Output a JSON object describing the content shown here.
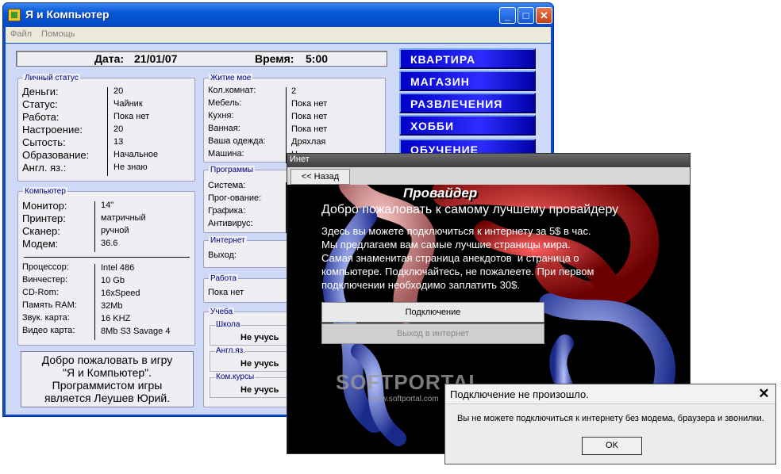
{
  "main_window": {
    "title": "Я и Компьютер",
    "menu": [
      "Файл",
      "Помощь"
    ],
    "date_label": "Дата:",
    "date_value": "21/01/07",
    "time_label": "Время:",
    "time_value": "5:00",
    "personal_status": {
      "legend": "Личный статус",
      "rows": [
        {
          "label": "Деньги:",
          "value": "20"
        },
        {
          "label": "Статус:",
          "value": "Чайник"
        },
        {
          "label": "Работа:",
          "value": "Пока нет"
        },
        {
          "label": "Настроение:",
          "value": "20"
        },
        {
          "label": "Сытость:",
          "value": "13"
        },
        {
          "label": "Образование:",
          "value": "Начальное"
        },
        {
          "label": "Англ. яз.:",
          "value": "Не знаю"
        }
      ]
    },
    "computer": {
      "legend": "Компьютер",
      "top_rows": [
        {
          "label": "Монитор:",
          "value": "14\""
        },
        {
          "label": "Принтер:",
          "value": "матричный"
        },
        {
          "label": "Сканер:",
          "value": "ручной"
        },
        {
          "label": "Модем:",
          "value": "36.6"
        }
      ],
      "bottom_rows": [
        {
          "label": "Процессор:",
          "value": "Intel 486"
        },
        {
          "label": "Винчестер:",
          "value": "10 Gb"
        },
        {
          "label": "CD-Rom:",
          "value": "16xSpeed"
        },
        {
          "label": "Память RAM:",
          "value": "32Mb"
        },
        {
          "label": "Звук. карта:",
          "value": "16 KHZ"
        },
        {
          "label": "Видео карта:",
          "value": "8Mb S3 Savage 4"
        }
      ]
    },
    "living": {
      "legend": "Житие мое",
      "rows": [
        {
          "label": "Кол.комнат:",
          "value": "2"
        },
        {
          "label": "Мебель:",
          "value": "Пока нет"
        },
        {
          "label": "Кухня:",
          "value": "Пока нет"
        },
        {
          "label": "Ванная:",
          "value": "Пока нет"
        },
        {
          "label": "Ваша одежда:",
          "value": "Дряхлая"
        },
        {
          "label": "Машина:",
          "value": "Н"
        }
      ]
    },
    "programs": {
      "legend": "Программы",
      "rows": [
        "Система:",
        "Прог-ование:",
        "Графика:",
        "Антивирус:"
      ]
    },
    "internet": {
      "legend": "Интернет",
      "label": "Выход:"
    },
    "work": {
      "legend": "Работа",
      "value": "Пока нет"
    },
    "study": {
      "legend": "Учеба",
      "items": [
        {
          "label": "Школа",
          "value": "Не учусь"
        },
        {
          "label": "Англ.яз.",
          "value": "Не учусь"
        },
        {
          "label": "Ком.курсы",
          "value": "Не учусь"
        }
      ]
    },
    "nav_buttons": [
      "КВАРТИРА",
      "МАГАЗИН",
      "РАЗВЛЕЧЕНИЯ",
      "ХОББИ",
      "ОБУЧЕНИЕ"
    ],
    "welcome_text": [
      "Добро пожаловать в игру",
      "\"Я и Компьютер\".",
      "Программистом игры",
      "является Леушев Юрий."
    ]
  },
  "inet_window": {
    "title": "Инет",
    "back_button": "<< Назад",
    "heading": "Провайдер",
    "welcome": "Добро пожаловать к самому лучшему провайдеру",
    "description": "Здесь вы можете подключиться к интернету за 5$ в час.\nМы предлагаем вам самые лучшие страницы мира.\nСамая знаменитая страница анекдотов  и страница о\nкомпьютере. Подключайтесь, не пожалеете. При первом\nподключении необходимо заплатить 30$.",
    "connect_button": "Подключение",
    "exit_button": "Выход в интернет",
    "watermark": "SOFTPORTAL",
    "watermark_url": "www.softportal.com"
  },
  "dialog": {
    "title": "Подключение не  произошло.",
    "message": "Вы не можете подключиться к интернету без модема, браузера и звонилки.",
    "ok": "OK"
  },
  "colors": {
    "window_blue": "#0a4cc9",
    "nav_blue": "#1a1aff",
    "client_bg": "#cdd9f7"
  }
}
